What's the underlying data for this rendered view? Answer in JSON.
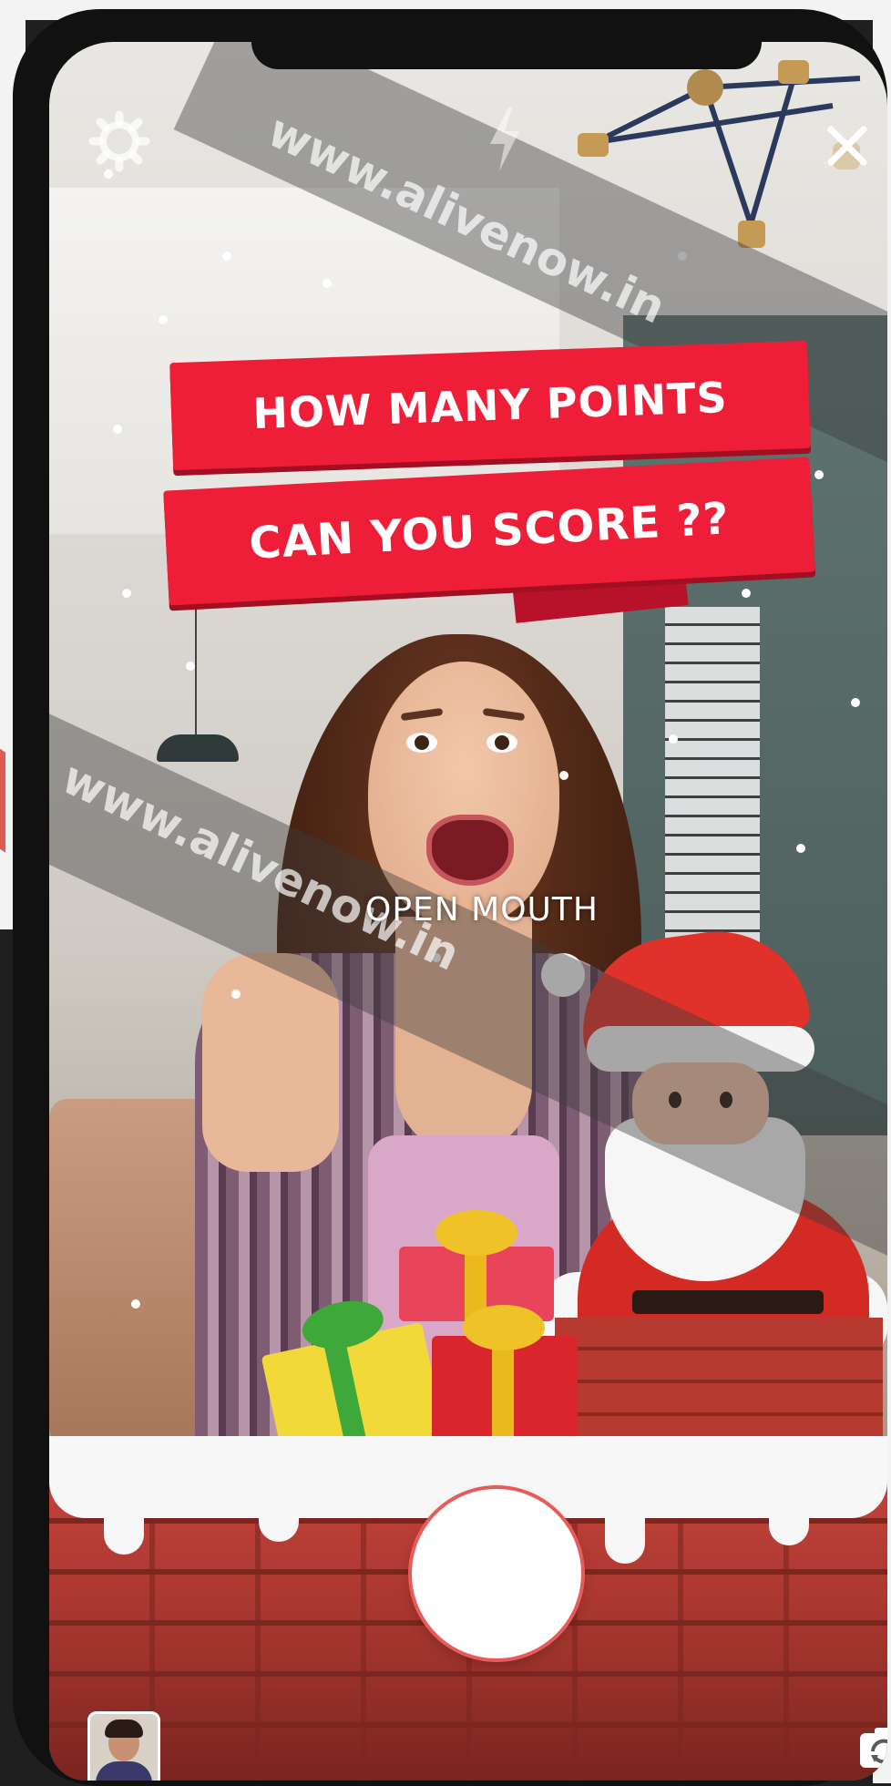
{
  "watermark": {
    "text1": "www.alivenow.in",
    "text2": "www.alivenow.in"
  },
  "banner": {
    "line1": "HOW MANY POINTS",
    "line2": "CAN YOU SCORE ??"
  },
  "prompt": {
    "text": "OPEN MOUTH"
  },
  "icons": {
    "settings": "gear-icon",
    "flash": "flash-icon",
    "close": "close-icon",
    "capture": "capture-button",
    "avatar": "avatar-thumbnail",
    "flip_camera": "camera-flip-icon"
  },
  "colors": {
    "banner_red": "#ee1e38",
    "brick_red": "#b73a30",
    "snow": "#f7f7f7"
  }
}
